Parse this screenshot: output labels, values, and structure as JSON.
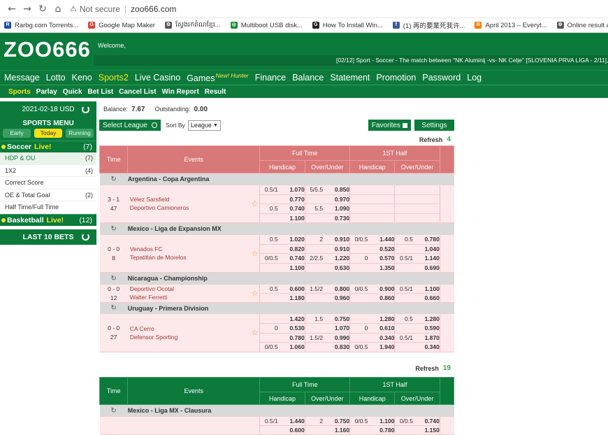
{
  "browser": {
    "url": "zoo666.com",
    "security": "Not secure",
    "bookmarks": [
      {
        "label": "Rarbg.com Torrents...",
        "color": "#1f4ea3",
        "glyph": "R"
      },
      {
        "label": "Google Map Maker",
        "color": "#e44134",
        "glyph": "G"
      },
      {
        "label": "ស្វែងរកតំណខ្មែរ...",
        "color": "#555",
        "glyph": "⚙"
      },
      {
        "label": "Multiboot USB disk...",
        "color": "#1c8a3a",
        "glyph": "◎"
      },
      {
        "label": "How To Install Win...",
        "color": "#222",
        "glyph": "G"
      },
      {
        "label": "(1) 再的要業死我许...",
        "color": "#3b5998",
        "glyph": "f"
      },
      {
        "label": "April 2013 – Everyt...",
        "color": "#f57d00",
        "glyph": "B"
      },
      {
        "label": "Online result app",
        "color": "#555",
        "glyph": "⚙"
      },
      {
        "label": "FiberSource",
        "color": "#f0a000",
        "glyph": "F"
      }
    ]
  },
  "site": {
    "logo": "ZOO666",
    "welcome": "Welcome,",
    "ticker": "[02/12] Sport - Soccer - The match between \"NK Aluminij -vs- NK Celje\" [SLOVENIA PRVA LIGA - 2/11], \"Gua"
  },
  "nav": [
    {
      "label": "Message",
      "active": false
    },
    {
      "label": "Lotto",
      "active": false
    },
    {
      "label": "Keno",
      "active": false
    },
    {
      "label": "Sports2",
      "active": true
    },
    {
      "label": "Live Casino",
      "active": false
    },
    {
      "label": "Games",
      "sup": "New! Hunter",
      "active": false
    },
    {
      "label": "Finance",
      "active": false
    },
    {
      "label": "Balance",
      "active": false
    },
    {
      "label": "Statement",
      "active": false
    },
    {
      "label": "Promotion",
      "active": false
    },
    {
      "label": "Password",
      "active": false
    },
    {
      "label": "Log",
      "active": false
    }
  ],
  "subnav": [
    "Sports",
    "Parlay",
    "Quick",
    "Bet List",
    "Cancel List",
    "Win Report",
    "Result"
  ],
  "sidebar": {
    "date": "2021-02-18 USD",
    "menu_title": "SPORTS MENU",
    "tabs": [
      "Early",
      "Today",
      "Running"
    ],
    "soccer": {
      "label": "Soccer",
      "live": "Live!",
      "count": "(7)"
    },
    "items": [
      {
        "label": "HDP & OU",
        "count": "(7)"
      },
      {
        "label": "1X2",
        "count": "(4)"
      },
      {
        "label": "Correct Score",
        "count": ""
      },
      {
        "label": "OE & Total Goal",
        "count": "(2)"
      },
      {
        "label": "Half Time/Full Time",
        "count": ""
      }
    ],
    "basketball": {
      "label": "Basketball",
      "live": "Live!",
      "count": "(12)"
    },
    "last10": "LAST 10 BETS"
  },
  "account": {
    "balance_label": "Balance:",
    "balance": "7.67",
    "outstanding_label": "Outstanding:",
    "outstanding": "0.00"
  },
  "controls": {
    "select_league": "Select League",
    "sort_by": "Sort By",
    "sort_value": "League",
    "favorites": "Favorites",
    "settings": "Settings"
  },
  "refresh": {
    "label": "Refresh",
    "count1": "4",
    "count2": "19"
  },
  "table_headers": {
    "time": "Time",
    "events": "Events",
    "full_time": "Full Time",
    "first_half": "1ST Half",
    "handicap": "Handicap",
    "over_under": "Over/Under"
  },
  "leagues": [
    {
      "name": "Argentina - Copa Argentina",
      "matches": [
        {
          "score": "3 - 1",
          "minute": "47",
          "home": "Vélez Sarsfield",
          "away": "Deportivo Camioneros",
          "rows": [
            [
              [
                "0.5/1",
                "1.070"
              ],
              [
                "5/5.5",
                "0.850"
              ],
              [
                "",
                ""
              ],
              [
                "",
                ""
              ]
            ],
            [
              [
                "",
                "0.770"
              ],
              [
                "",
                "0.970"
              ],
              [
                "",
                ""
              ],
              [
                "",
                ""
              ]
            ],
            [
              [
                "0.5",
                "0.740"
              ],
              [
                "5.5",
                "1.090"
              ],
              [
                "",
                ""
              ],
              [
                "",
                ""
              ]
            ],
            [
              [
                "",
                "1.100"
              ],
              [
                "",
                "0.730"
              ],
              [
                "",
                ""
              ],
              [
                "",
                ""
              ]
            ]
          ]
        }
      ]
    },
    {
      "name": "Mexico - Liga de Expansion MX",
      "matches": [
        {
          "score": "0 - 0",
          "minute": "8",
          "home": "Venados FC",
          "away": "Tepatitlán de Morelos",
          "rows": [
            [
              [
                "0.5",
                "1.020"
              ],
              [
                "2",
                "0.910"
              ],
              [
                "0/0.5",
                "1.440"
              ],
              [
                "0.5",
                "0.780"
              ]
            ],
            [
              [
                "",
                "0.820"
              ],
              [
                "",
                "0.910"
              ],
              [
                "",
                "0.520"
              ],
              [
                "",
                "1.040"
              ]
            ],
            [
              [
                "0/0.5",
                "0.740"
              ],
              [
                "2/2.5",
                "1.220"
              ],
              [
                "0",
                "0.570"
              ],
              [
                "0.5/1",
                "1.140"
              ]
            ],
            [
              [
                "",
                "1.100"
              ],
              [
                "",
                "0.630"
              ],
              [
                "",
                "1.350"
              ],
              [
                "",
                "0.690"
              ]
            ]
          ]
        }
      ]
    },
    {
      "name": "Nicaragua - Championship",
      "matches": [
        {
          "score": "0 - 0",
          "minute": "12",
          "home": "Deportivo Ocotal",
          "away": "Walter Ferretti",
          "rows": [
            [
              [
                "0.5",
                "0.600"
              ],
              [
                "1.5/2",
                "0.800"
              ],
              [
                "0/0.5",
                "0.900"
              ],
              [
                "0.5/1",
                "1.100"
              ]
            ],
            [
              [
                "",
                "1.180"
              ],
              [
                "",
                "0.960"
              ],
              [
                "",
                "0.860"
              ],
              [
                "",
                "0.660"
              ]
            ]
          ]
        }
      ]
    },
    {
      "name": "Uruguay - Primera Division",
      "matches": [
        {
          "score": "0 - 0",
          "minute": "27",
          "home": "CA Cerro",
          "away": "Defensor Sporting",
          "rows": [
            [
              [
                "",
                "1.420"
              ],
              [
                "1.5",
                "0.750"
              ],
              [
                "",
                "1.280"
              ],
              [
                "0.5",
                "1.280"
              ]
            ],
            [
              [
                "0",
                "0.530"
              ],
              [
                "",
                "1.070"
              ],
              [
                "0",
                "0.610"
              ],
              [
                "",
                "0.590"
              ]
            ],
            [
              [
                "",
                "0.780"
              ],
              [
                "1.5/2",
                "0.990"
              ],
              [
                "",
                "0.340"
              ],
              [
                "0.5/1",
                "1.870"
              ]
            ],
            [
              [
                "0/0.5",
                "1.060"
              ],
              [
                "",
                "0.830"
              ],
              [
                "0/0.5",
                "1.940"
              ],
              [
                "",
                "0.340"
              ]
            ]
          ]
        }
      ]
    }
  ],
  "second_table": {
    "league": "Mexico - Liga MX - Clausura",
    "rows": [
      [
        [
          "0.5/1",
          "1.440"
        ],
        [
          "2",
          "0.750"
        ],
        [
          "0/0.5",
          "1.100"
        ],
        [
          "0/0.5",
          "0.740"
        ]
      ],
      [
        [
          "",
          "0.600"
        ],
        [
          "",
          "1.160"
        ],
        [
          "",
          "0.780"
        ],
        [
          "",
          "1.150"
        ]
      ]
    ]
  }
}
